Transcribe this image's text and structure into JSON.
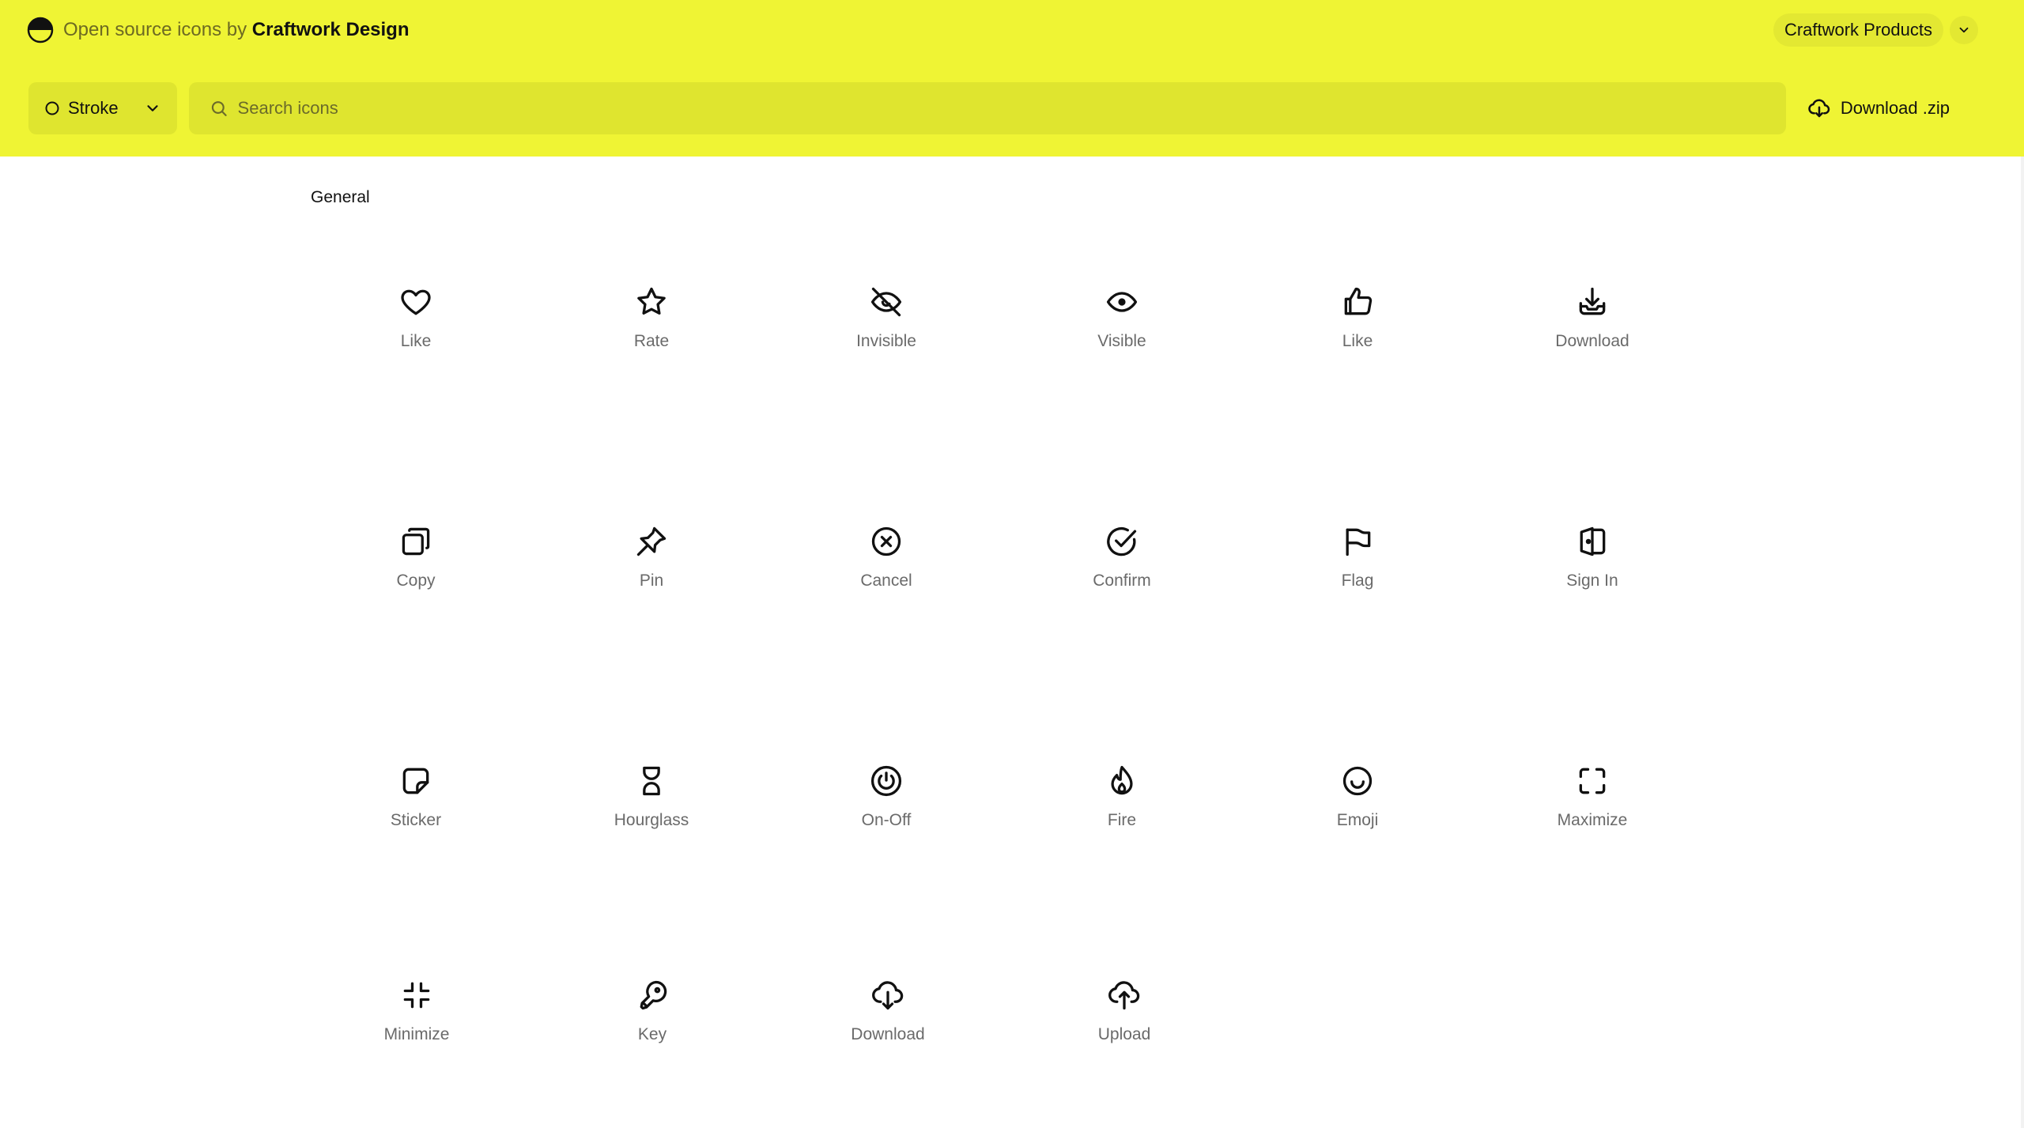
{
  "colors": {
    "header_bg": "#eff434",
    "input_bg": "#dfe52f",
    "button_bg": "#e3e832",
    "icon_stroke": "#111111",
    "label_text": "#6a6a6a"
  },
  "header": {
    "brand_prefix": "Open source icons by",
    "brand_name": "Craftwork Design",
    "logo_icon": "half-moon-circle-icon",
    "products_label": "Craftwork Products"
  },
  "toolbar": {
    "style_select": {
      "selected": "Stroke",
      "icon": "circle-outline-icon"
    },
    "search": {
      "placeholder": "Search icons",
      "value": ""
    },
    "download_label": "Download .zip"
  },
  "section": {
    "title": "General"
  },
  "icons": [
    {
      "label": "Like",
      "icon": "heart-icon"
    },
    {
      "label": "Rate",
      "icon": "star-icon"
    },
    {
      "label": "Invisible",
      "icon": "eye-off-icon"
    },
    {
      "label": "Visible",
      "icon": "eye-icon"
    },
    {
      "label": "Like",
      "icon": "thumbs-up-icon"
    },
    {
      "label": "Download",
      "icon": "download-tray-icon"
    },
    {
      "label": "Copy",
      "icon": "copy-icon"
    },
    {
      "label": "Pin",
      "icon": "pin-icon"
    },
    {
      "label": "Cancel",
      "icon": "x-circle-icon"
    },
    {
      "label": "Confirm",
      "icon": "check-circle-icon"
    },
    {
      "label": "Flag",
      "icon": "flag-icon"
    },
    {
      "label": "Sign In",
      "icon": "sign-in-icon"
    },
    {
      "label": "Sticker",
      "icon": "sticker-icon"
    },
    {
      "label": "Hourglass",
      "icon": "hourglass-icon"
    },
    {
      "label": "On-Off",
      "icon": "power-icon"
    },
    {
      "label": "Fire",
      "icon": "fire-icon"
    },
    {
      "label": "Emoji",
      "icon": "smile-icon"
    },
    {
      "label": "Maximize",
      "icon": "maximize-icon"
    },
    {
      "label": "Minimize",
      "icon": "minimize-icon"
    },
    {
      "label": "Key",
      "icon": "key-icon"
    },
    {
      "label": "Download",
      "icon": "cloud-download-icon"
    },
    {
      "label": "Upload",
      "icon": "cloud-upload-icon"
    }
  ]
}
